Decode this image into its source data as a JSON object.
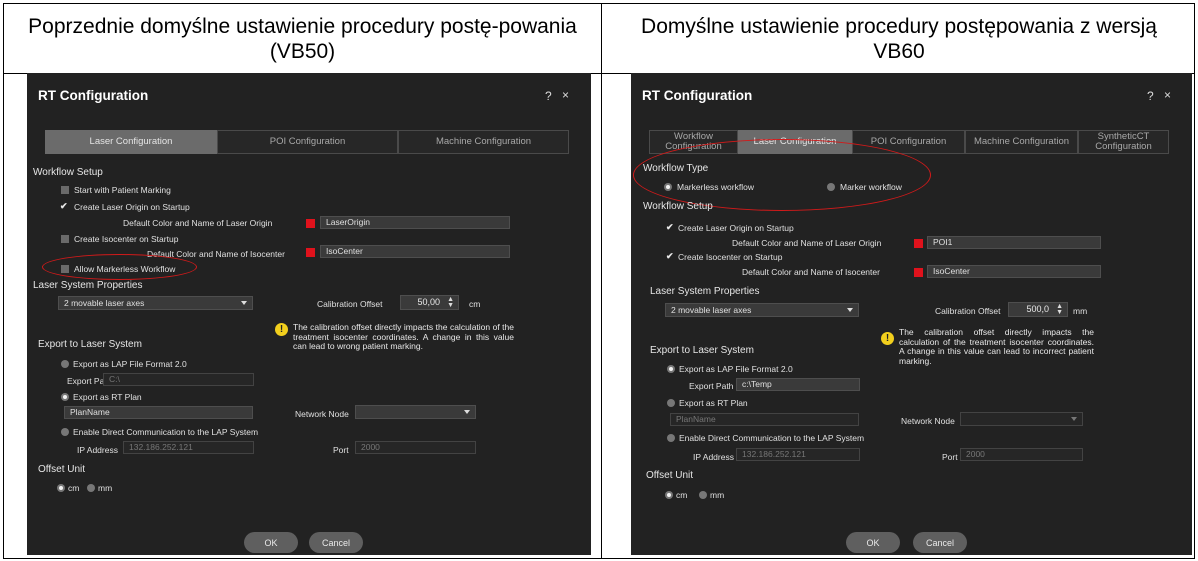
{
  "headers": {
    "left": "Poprzednie domyślne ustawienie procedury postę-powania (VB50)",
    "right": "Domyślne ustawienie procedury postępowania z wersją VB60"
  },
  "colors": {
    "dialog_bg": "#222222",
    "accent_red": "#e0121c",
    "highlight_ellipse": "#d11a1a",
    "warning": "#f2cf1d"
  },
  "left_dialog": {
    "title": "RT Configuration",
    "help": "?",
    "close": "×",
    "tabs": [
      "Laser Configuration",
      "POI Configuration",
      "Machine Configuration"
    ],
    "active_tab": "Laser Configuration",
    "workflow_setup": "Workflow Setup",
    "start_patient_marking": "Start with Patient Marking",
    "create_laser_origin": "Create Laser Origin on Startup",
    "laser_origin_label": "Default Color and Name of Laser Origin",
    "laser_origin_value": "LaserOrigin",
    "create_isocenter": "Create Isocenter on Startup",
    "isocenter_label": "Default Color and Name of Isocenter",
    "isocenter_value": "IsoCenter",
    "allow_markerless": "Allow Markerless Workflow",
    "laser_system_properties": "Laser System Properties",
    "laser_axes": "2 movable laser axes",
    "calibration_offset_label": "Calibration Offset",
    "calibration_offset_value": "50,00",
    "calibration_unit": "cm",
    "warning_text": "The calibration offset directly impacts the calculation of the treatment isocenter coordinates. A change in this value can lead to wrong patient marking.",
    "export_to_laser": "Export to Laser System",
    "export_lap": "Export as LAP File Format 2.0",
    "export_path_label": "Export Path",
    "export_path_value": "C:\\",
    "export_rt_plan": "Export as RT Plan",
    "plan_name_value": "PlanName",
    "network_node_label": "Network Node",
    "network_node_value": "",
    "enable_direct": "Enable Direct Communication to the LAP System",
    "ip_label": "IP Address",
    "ip_value": "132.186.252.121",
    "port_label": "Port",
    "port_value": "2000",
    "offset_unit": "Offset Unit",
    "unit_cm": "cm",
    "unit_mm": "mm",
    "ok": "OK",
    "cancel": "Cancel"
  },
  "right_dialog": {
    "title": "RT Configuration",
    "help": "?",
    "close": "×",
    "tabs": [
      "Workflow Configuration",
      "Laser Configuration",
      "POI Configuration",
      "Machine Configuration",
      "SyntheticCT Configuration"
    ],
    "active_tab": "Laser Configuration",
    "workflow_type": "Workflow Type",
    "markerless": "Markerless workflow",
    "marker": "Marker workflow",
    "workflow_setup": "Workflow Setup",
    "create_laser_origin": "Create Laser Origin on Startup",
    "laser_origin_label": "Default Color and Name of Laser Origin",
    "laser_origin_value": "POI1",
    "create_isocenter": "Create Isocenter on Startup",
    "isocenter_label": "Default Color and Name of Isocenter",
    "isocenter_value": "IsoCenter",
    "laser_system_properties": "Laser System Properties",
    "laser_axes": "2 movable laser axes",
    "calibration_offset_label": "Calibration Offset",
    "calibration_offset_value": "500,0",
    "calibration_unit": "mm",
    "warning_text": "The calibration offset directly impacts the calculation of the treatment isocenter coordinates. A change in this value can lead to incorrect patient marking.",
    "export_to_laser": "Export to Laser System",
    "export_lap": "Export as LAP File Format 2.0",
    "export_path_label": "Export Path",
    "export_path_value": "c:\\Temp",
    "export_rt_plan": "Export as RT Plan",
    "plan_name_value": "PlanName",
    "network_node_label": "Network Node",
    "network_node_value": "",
    "enable_direct": "Enable Direct Communication to the LAP System",
    "ip_label": "IP Address",
    "ip_value": "132.186.252.121",
    "port_label": "Port",
    "port_value": "2000",
    "offset_unit": "Offset Unit",
    "unit_cm": "cm",
    "unit_mm": "mm",
    "ok": "OK",
    "cancel": "Cancel"
  }
}
